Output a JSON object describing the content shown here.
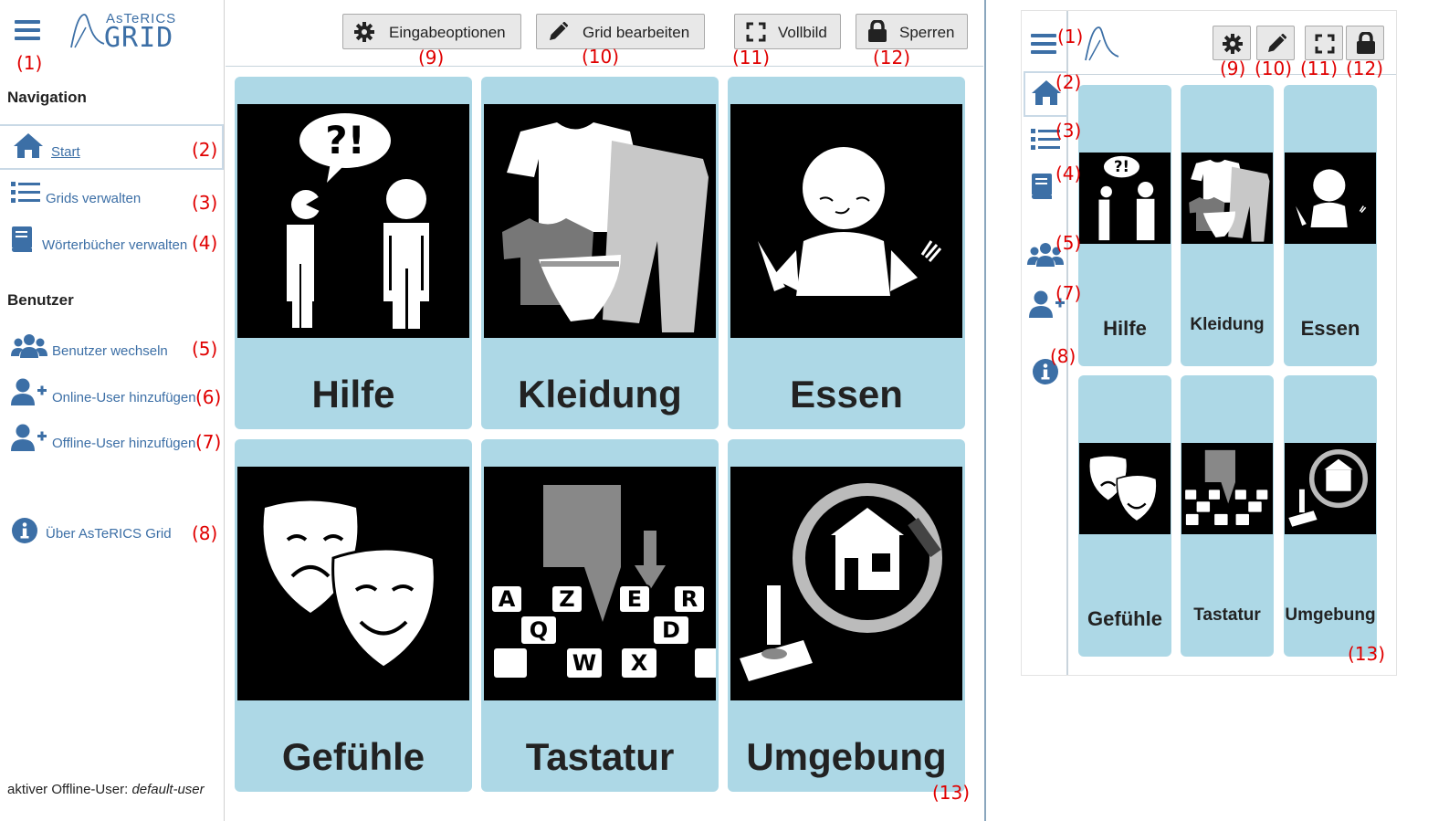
{
  "app": {
    "logo_top": "AsTeRICS",
    "logo_main": "GRID"
  },
  "colors": {
    "accent": "#3c6fa6",
    "cell_background": "#add8e6",
    "annotation": "#e00000",
    "picture_background": "#000000"
  },
  "sidebar": {
    "navigation_heading": "Navigation",
    "users_heading": "Benutzer",
    "items": [
      {
        "label": "Start",
        "icon": "home-icon",
        "active": true
      },
      {
        "label": "Grids verwalten",
        "icon": "list-icon",
        "active": false
      },
      {
        "label": "Wörterbücher verwalten",
        "icon": "book-icon",
        "active": false
      },
      {
        "label": "Benutzer wechseln",
        "icon": "users-icon",
        "active": false
      },
      {
        "label": "Online-User hinzufügen",
        "icon": "user-plus-icon",
        "active": false
      },
      {
        "label": "Offline-User hinzufügen",
        "icon": "user-plus-icon",
        "active": false
      },
      {
        "label": "Über AsTeRICS Grid",
        "icon": "info-icon",
        "active": false
      }
    ],
    "footer_prefix": "aktiver Offline-User:",
    "footer_user": "default-user"
  },
  "toolbar": {
    "buttons": [
      {
        "label": "Eingabeoptionen",
        "icon": "gear-icon"
      },
      {
        "label": "Grid bearbeiten",
        "icon": "pencil-icon"
      },
      {
        "label": "Vollbild",
        "icon": "fullscreen-icon"
      },
      {
        "label": "Sperren",
        "icon": "lock-icon"
      }
    ]
  },
  "grid": {
    "cells": [
      {
        "label": "Hilfe",
        "icon": "help-speech-pictogram"
      },
      {
        "label": "Kleidung",
        "icon": "clothing-pictogram"
      },
      {
        "label": "Essen",
        "icon": "eating-pictogram"
      },
      {
        "label": "Gefühle",
        "icon": "masks-pictogram"
      },
      {
        "label": "Tastatur",
        "icon": "keyboard-pictogram"
      },
      {
        "label": "Umgebung",
        "icon": "home-environment-pictogram"
      }
    ]
  },
  "annotations": [
    "(1)",
    "(2)",
    "(3)",
    "(4)",
    "(5)",
    "(6)",
    "(7)",
    "(8)",
    "(9)",
    "(10)",
    "(11)",
    "(12)",
    "(13)"
  ]
}
